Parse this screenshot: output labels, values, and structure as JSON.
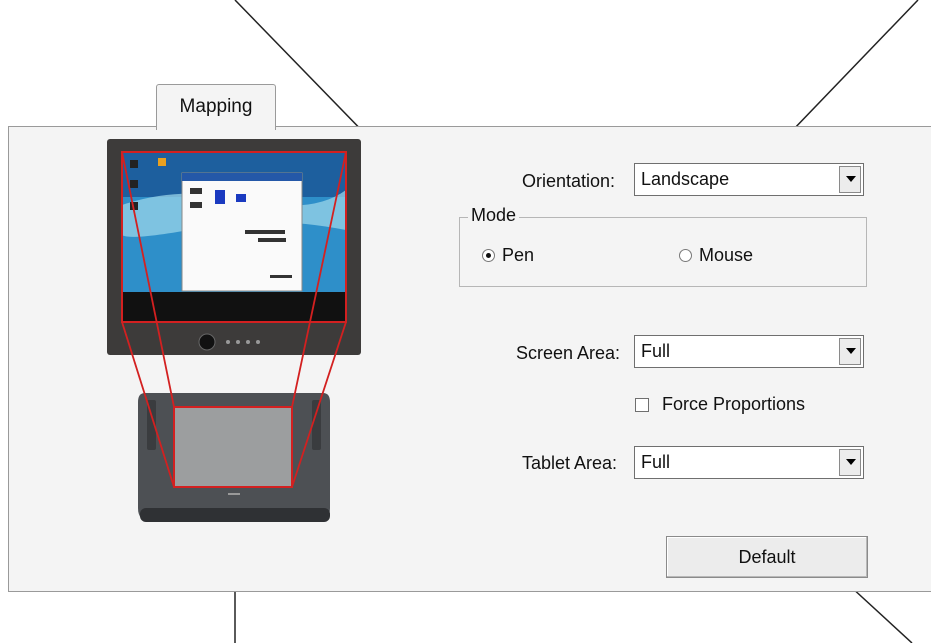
{
  "tabs": [
    {
      "label": "Mapping",
      "selected": true
    }
  ],
  "orientation": {
    "label": "Orientation:",
    "value": "Landscape"
  },
  "mode": {
    "title": "Mode",
    "options": [
      {
        "label": "Pen",
        "selected": true
      },
      {
        "label": "Mouse",
        "selected": false
      }
    ]
  },
  "screen_area": {
    "label": "Screen Area:",
    "value": "Full"
  },
  "force_proportions": {
    "label": "Force Proportions",
    "checked": false
  },
  "tablet_area": {
    "label": "Tablet Area:",
    "value": "Full"
  },
  "default_button": {
    "label": "Default"
  },
  "icons": [
    "monitor-preview-icon",
    "tablet-preview-icon",
    "dropdown-arrow-icon"
  ],
  "colors": {
    "mapping_lines": "#d32020",
    "panel_bg": "#f4f4f4",
    "tablet_body": "#4d5054"
  }
}
